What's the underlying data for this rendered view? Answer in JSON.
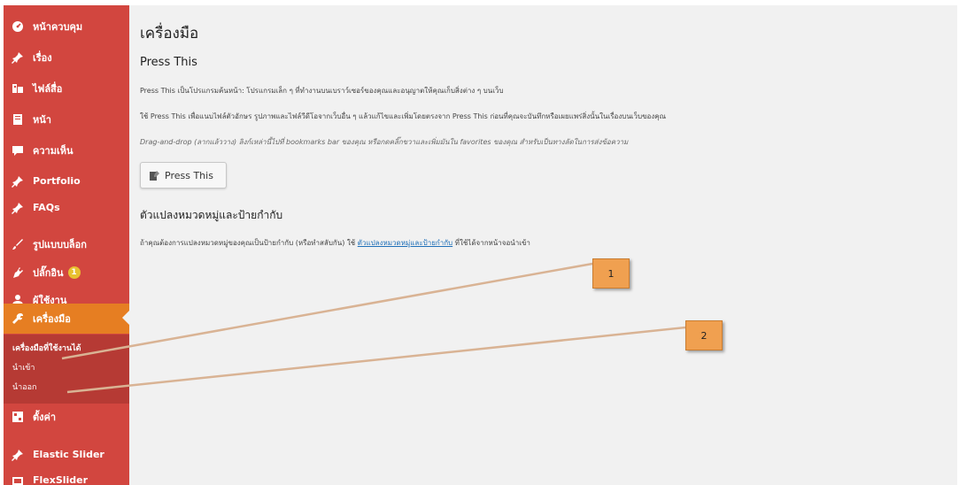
{
  "sidebar": {
    "items": [
      {
        "label": "หน้าควบคุม",
        "icon": "dashboard-icon"
      },
      {
        "label": "เรื่อง",
        "icon": "pin-icon"
      },
      {
        "label": "ไฟล์สื่อ",
        "icon": "media-icon"
      },
      {
        "label": "หน้า",
        "icon": "page-icon"
      },
      {
        "label": "ความเห็น",
        "icon": "comment-icon"
      },
      {
        "label": "Portfolio",
        "icon": "pin-icon"
      },
      {
        "label": "FAQs",
        "icon": "pin-icon"
      },
      {
        "label": "รูปแบบบล็อก",
        "icon": "appearance-icon"
      },
      {
        "label": "ปลั๊กอิน",
        "icon": "plugin-icon",
        "badge": "1"
      },
      {
        "label": "ผู้ใช้งาน",
        "icon": "user-icon"
      },
      {
        "label": "เครื่องมือ",
        "icon": "tools-icon",
        "active": true
      },
      {
        "label": "ตั้งค่า",
        "icon": "settings-icon"
      },
      {
        "label": "Elastic Slider",
        "icon": "pin-icon"
      },
      {
        "label": "FlexSlider",
        "icon": "slider-icon"
      }
    ],
    "submenu": [
      {
        "label": "เครื่องมือที่ใช้งานได้"
      },
      {
        "label": "นำเข้า"
      },
      {
        "label": "นำออก"
      }
    ],
    "colors": {
      "background": "#d2463f",
      "active": "#e67e22",
      "submenu": "#b63a34"
    }
  },
  "main": {
    "title": "เครื่องมือ",
    "press_this": {
      "heading": "Press This",
      "p1": "Press This เป็นโปรแกรมค้นหน้า: โปรแกรมเล็ก ๆ ที่ทำงานบนเบราว์เซอร์ของคุณและอนุญาตให้คุณเก็บสิ่งต่าง ๆ บนเว็บ",
      "p2": "ใช้ Press This เพื่อแนบไฟล์ตัวอักษร รูปภาพและไฟล์วีดีโอจากเว็บอื่น ๆ แล้วแก้ไขและเพิ่มโดยตรงจาก Press This ก่อนที่คุณจะบันทึกหรือเผยแพร่สิ่งนั้นในเรื่องบนเว็บของคุณ",
      "p3": "Drag-and-drop (ลากแล้ววาง) ลิงก์เหล่านี้ไปที่ bookmarks bar ของคุณ หรือกดคลิ๊กขวาและเพิ่มมันใน favorites ของคุณ สำหรับเป็นทางลัดในการส่งข้อความ",
      "button_label": "Press This"
    },
    "converter": {
      "heading": "ตัวแปลงหมวดหมู่และป้ายกำกับ",
      "text_before": "ถ้าคุณต้องการแปลงหมวดหมู่ของคุณเป็นป้ายกำกับ (หรือทำสลับกัน) ใช้ ",
      "link": "ตัวแปลงหมวดหมู่และป้ายกำกับ",
      "text_after": " ที่ใช้ได้จากหน้าจอนำเข้า"
    }
  },
  "annotations": [
    {
      "label": "1"
    },
    {
      "label": "2"
    }
  ]
}
